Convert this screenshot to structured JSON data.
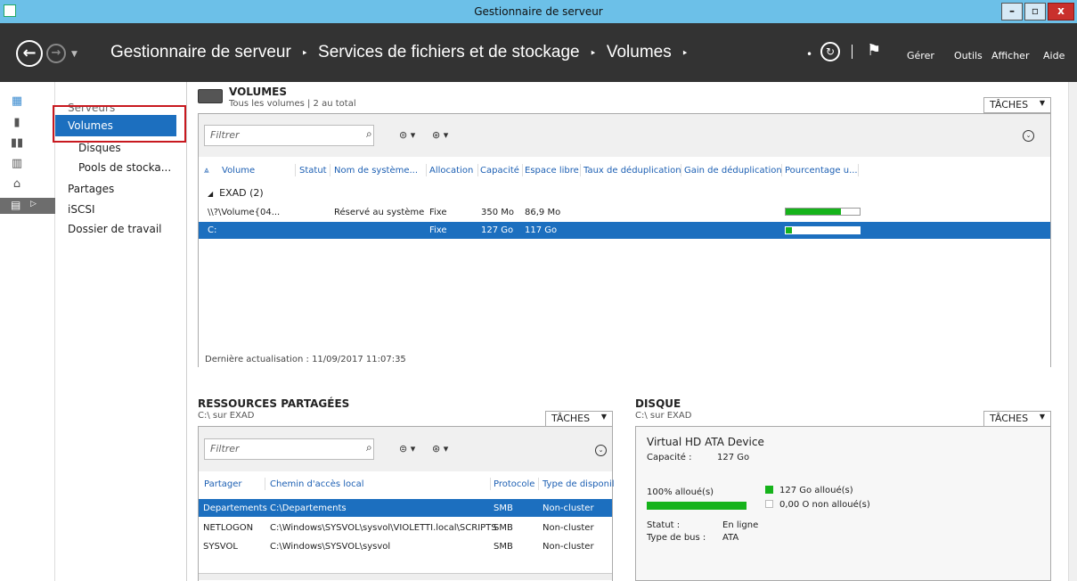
{
  "window": {
    "title": "Gestionnaire de serveur",
    "min": "–",
    "max": "▫",
    "close": "x"
  },
  "breadcrumb": {
    "part1": "Gestionnaire de serveur",
    "part2": "Services de fichiers et de stockage",
    "part3": "Volumes",
    "sep": "‣"
  },
  "menu": {
    "gerer": "Gérer",
    "outils": "Outils",
    "afficher": "Afficher",
    "aide": "Aide"
  },
  "sidenav": {
    "items": [
      "Serveurs",
      "Volumes",
      "Disques",
      "Pools de stocka...",
      "Partages",
      "iSCSI",
      "Dossier de travail"
    ]
  },
  "volumes": {
    "title": "VOLUMES",
    "subtitle": "Tous les volumes | 2 au total",
    "tasks": "TÂCHES",
    "filter_placeholder": "Filtrer",
    "columns": [
      "Volume",
      "Statut",
      "Nom de système...",
      "Allocation",
      "Capacité",
      "Espace libre",
      "Taux de déduplication",
      "Gain de déduplication",
      "Pourcentage u..."
    ],
    "group": "EXAD (2)",
    "rows": [
      {
        "volume": "\\\\?\\Volume{04...",
        "statut": "",
        "nom": "Réservé au système",
        "allocation": "Fixe",
        "capacite": "350 Mo",
        "libre": "86,9 Mo",
        "pct": 0.75
      },
      {
        "volume": "C:",
        "statut": "",
        "nom": "",
        "allocation": "Fixe",
        "capacite": "127 Go",
        "libre": "117 Go",
        "pct": 0.08
      }
    ],
    "footer": "Dernière actualisation : 11/09/2017 11:07:35"
  },
  "shares": {
    "title": "RESSOURCES PARTAGÉES",
    "subtitle": "C:\\ sur EXAD",
    "tasks": "TÂCHES",
    "filter_placeholder": "Filtrer",
    "columns": [
      "Partager",
      "Chemin d'accès local",
      "Protocole",
      "Type de disponil"
    ],
    "rows": [
      {
        "name": "Departements",
        "path": "C:\\Departements",
        "proto": "SMB",
        "type": "Non-cluster"
      },
      {
        "name": "NETLOGON",
        "path": "C:\\Windows\\SYSVOL\\sysvol\\VIOLETTI.local\\SCRIPTS",
        "proto": "SMB",
        "type": "Non-cluster"
      },
      {
        "name": "SYSVOL",
        "path": "C:\\Windows\\SYSVOL\\sysvol",
        "proto": "SMB",
        "type": "Non-cluster"
      }
    ]
  },
  "disk": {
    "title": "DISQUE",
    "subtitle": "C:\\ sur EXAD",
    "tasks": "TÂCHES",
    "device": "Virtual HD ATA Device",
    "cap_label": "Capacité :",
    "cap_value": "127 Go",
    "alloc_pct": "100% alloué(s)",
    "alloc_fraction": 1.0,
    "legend_alloc": "127 Go alloué(s)",
    "legend_free": "0,00 O non alloué(s)",
    "status_label": "Statut :",
    "status_value": "En ligne",
    "bus_label": "Type de bus :",
    "bus_value": "ATA"
  },
  "colors": {
    "accent": "#1c6fbf",
    "bar": "#16b31b",
    "titlebar": "#6cc0e8",
    "navbar": "#333333"
  }
}
